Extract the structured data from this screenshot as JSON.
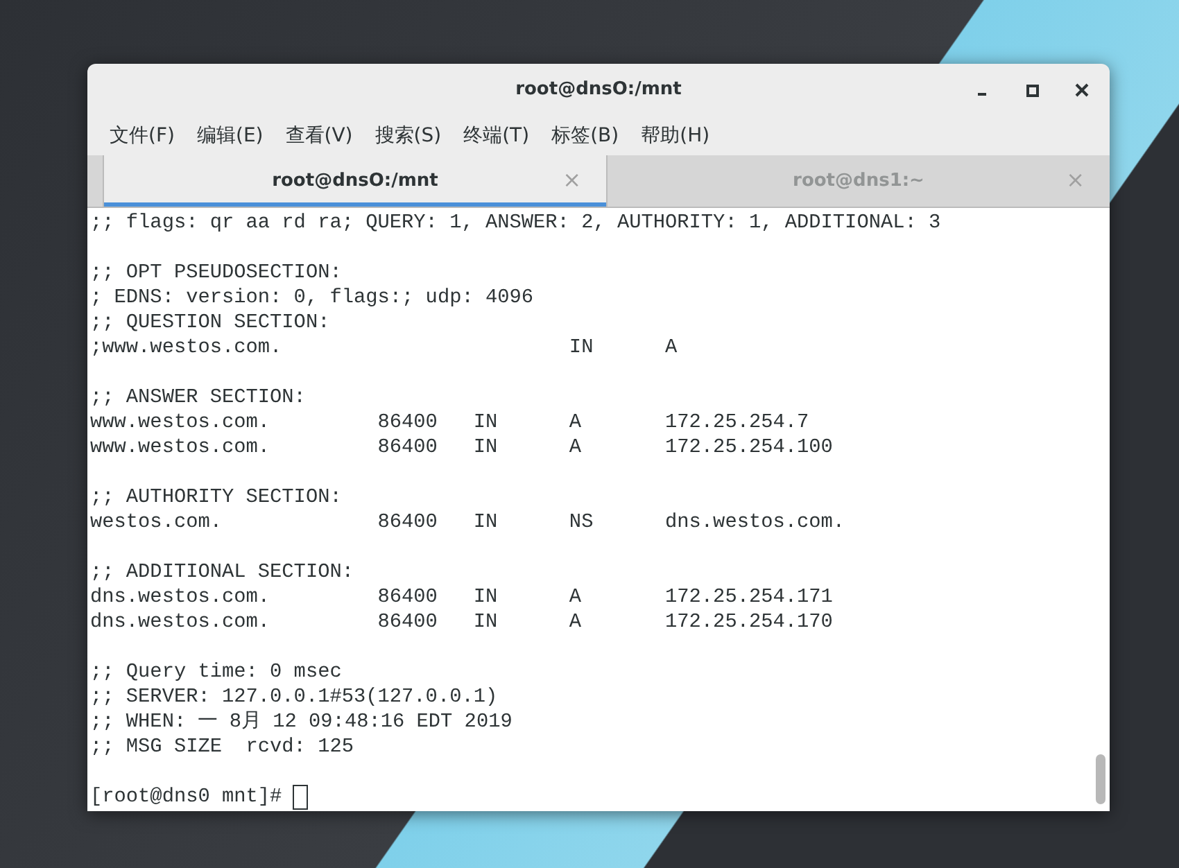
{
  "window": {
    "title": "root@dnsO:/mnt"
  },
  "menu": [
    "文件(F)",
    "编辑(E)",
    "查看(V)",
    "搜索(S)",
    "终端(T)",
    "标签(B)",
    "帮助(H)"
  ],
  "tabs": [
    {
      "label": "root@dnsO:/mnt",
      "selected": true,
      "close": "×"
    },
    {
      "label": "root@dns1:~",
      "selected": false,
      "close": "×"
    }
  ],
  "terminal": {
    "blocks": [
      [
        ";; flags: qr aa rd ra; QUERY: 1, ANSWER: 2, AUTHORITY: 1, ADDITIONAL: 3"
      ],
      [
        ";; OPT PSEUDOSECTION:",
        "; EDNS: version: 0, flags:; udp: 4096",
        ";; QUESTION SECTION:",
        ";www.westos.com.                        IN      A"
      ],
      [
        ";; ANSWER SECTION:",
        "www.westos.com.         86400   IN      A       172.25.254.7",
        "www.westos.com.         86400   IN      A       172.25.254.100"
      ],
      [
        ";; AUTHORITY SECTION:",
        "westos.com.             86400   IN      NS      dns.westos.com."
      ],
      [
        ";; ADDITIONAL SECTION:",
        "dns.westos.com.         86400   IN      A       172.25.254.171",
        "dns.westos.com.         86400   IN      A       172.25.254.170"
      ],
      [
        ";; Query time: 0 msec",
        ";; SERVER: 127.0.0.1#53(127.0.0.1)",
        ";; WHEN: 一 8月 12 09:48:16 EDT 2019",
        ";; MSG SIZE  rcvd: 125"
      ]
    ],
    "prompt": "[root@dns0 mnt]#"
  }
}
